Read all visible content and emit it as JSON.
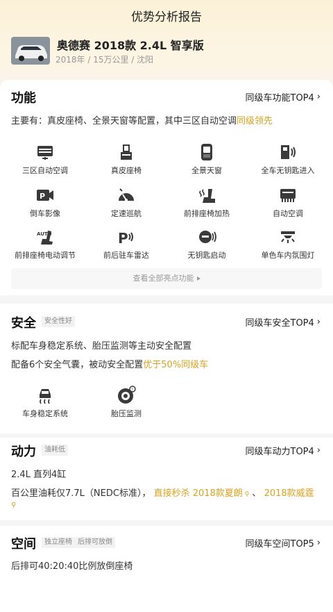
{
  "header": {
    "title": "优势分析报告"
  },
  "car": {
    "name": "奥德赛 2018款 2.4L 智享版",
    "meta": "2018年 / 15万公里 / 沈阳"
  },
  "features": {
    "title": "功能",
    "rank_link": "同级车功能TOP4",
    "summary_prefix": "主要有：真皮座椅、全景天窗等配置，其中三区自动空调",
    "summary_highlight": "同级领先",
    "items": [
      {
        "label": "三区自动空调",
        "icon": "ac-vent-icon"
      },
      {
        "label": "真皮座椅",
        "icon": "leather-seat-icon"
      },
      {
        "label": "全景天窗",
        "icon": "sunroof-icon"
      },
      {
        "label": "全车无钥匙进入",
        "icon": "keyless-entry-icon"
      },
      {
        "label": "倒车影像",
        "icon": "reverse-camera-icon"
      },
      {
        "label": "定速巡航",
        "icon": "cruise-control-icon"
      },
      {
        "label": "前排座椅加热",
        "icon": "seat-heating-icon"
      },
      {
        "label": "自动空调",
        "icon": "auto-ac-icon"
      },
      {
        "label": "前排座椅电动调节",
        "icon": "power-seat-icon"
      },
      {
        "label": "前后驻车雷达",
        "icon": "parking-radar-icon"
      },
      {
        "label": "无钥匙启动",
        "icon": "keyless-start-icon"
      },
      {
        "label": "单色车内氛围灯",
        "icon": "ambient-light-icon"
      }
    ],
    "more_label": "查看全部亮点功能"
  },
  "safety": {
    "title": "安全",
    "tag": "安全性好",
    "rank_link": "同级车安全TOP4",
    "line1": "标配车身稳定系统、胎压监测等主动安全配置",
    "line2_prefix": "配备6个安全气囊，被动安全配置",
    "line2_highlight": "优于50%同级车",
    "items": [
      {
        "label": "车身稳定系统",
        "icon": "stability-control-icon"
      },
      {
        "label": "胎压监测",
        "icon": "tire-pressure-icon"
      }
    ]
  },
  "power": {
    "title": "动力",
    "tag": "油耗低",
    "rank_link": "同级车动力TOP4",
    "engine": "2.4L 直列4缸",
    "fuel_prefix": "百公里油耗仅7.7L（NEDC标准），",
    "fuel_highlight1": "直接秒杀 2018款夏朗",
    "fuel_sep": "、",
    "fuel_highlight2": "2018款威霆"
  },
  "space": {
    "title": "空间",
    "tags": [
      "独立座椅",
      "后排可放倒"
    ],
    "rank_link": "同级车空间TOP5",
    "desc": "后排可40:20:40比例放倒座椅"
  },
  "colors": {
    "accent": "#d8a21e",
    "icon": "#3a3a3a"
  }
}
